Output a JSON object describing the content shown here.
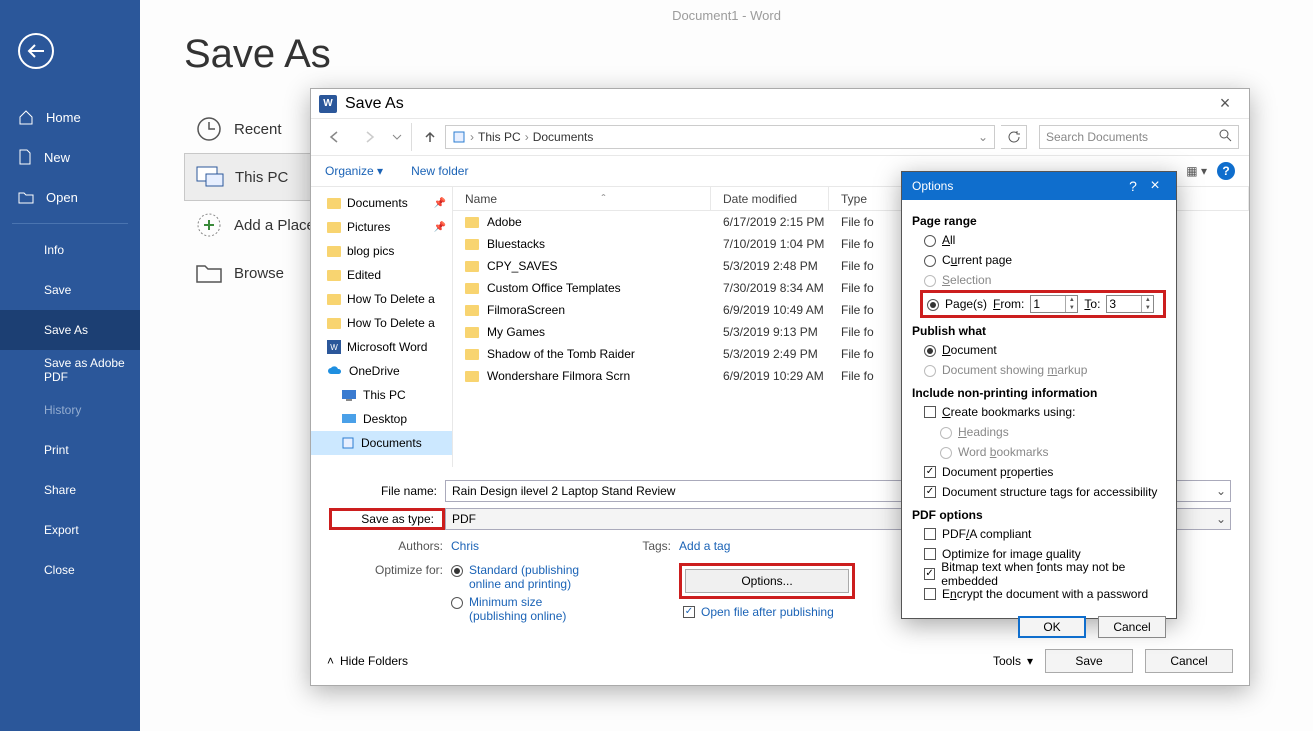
{
  "app_title": "Document1  -  Word",
  "backstage": {
    "title": "Save As",
    "nav": {
      "home": "Home",
      "new": "New",
      "open": "Open",
      "info": "Info",
      "save": "Save",
      "save_as": "Save As",
      "save_adobe": "Save as Adobe PDF",
      "history": "History",
      "print": "Print",
      "share": "Share",
      "export": "Export",
      "close": "Close"
    },
    "locations": {
      "recent": "Recent",
      "this_pc": "This PC",
      "add_place": "Add a Place",
      "browse": "Browse"
    }
  },
  "save_dialog": {
    "title": "Save As",
    "path": {
      "seg1": "This PC",
      "seg2": "Documents"
    },
    "search_placeholder": "Search Documents",
    "toolbar": {
      "organize": "Organize",
      "new_folder": "New folder"
    },
    "tree": [
      {
        "label": "Documents",
        "pin": true
      },
      {
        "label": "Pictures",
        "pin": true
      },
      {
        "label": "blog pics"
      },
      {
        "label": "Edited"
      },
      {
        "label": "How To Delete a"
      },
      {
        "label": "How To Delete a"
      },
      {
        "label": "Microsoft Word",
        "kind": "word"
      },
      {
        "label": "OneDrive",
        "kind": "cloud"
      },
      {
        "label": "This PC",
        "kind": "pc"
      },
      {
        "label": "Desktop",
        "kind": "desktop"
      },
      {
        "label": "Documents",
        "kind": "doclib",
        "sel": true
      }
    ],
    "columns": {
      "name": "Name",
      "date": "Date modified",
      "type": "Type"
    },
    "rows": [
      {
        "name": "Adobe",
        "date": "6/17/2019 2:15 PM",
        "type": "File fo"
      },
      {
        "name": "Bluestacks",
        "date": "7/10/2019 1:04 PM",
        "type": "File fo"
      },
      {
        "name": "CPY_SAVES",
        "date": "5/3/2019 2:48 PM",
        "type": "File fo"
      },
      {
        "name": "Custom Office Templates",
        "date": "7/30/2019 8:34 AM",
        "type": "File fo"
      },
      {
        "name": "FilmoraScreen",
        "date": "6/9/2019 10:49 AM",
        "type": "File fo"
      },
      {
        "name": "My Games",
        "date": "5/3/2019 9:13 PM",
        "type": "File fo"
      },
      {
        "name": "Shadow of the Tomb Raider",
        "date": "5/3/2019 2:49 PM",
        "type": "File fo"
      },
      {
        "name": "Wondershare Filmora Scrn",
        "date": "6/9/2019 10:29 AM",
        "type": "File fo"
      }
    ],
    "form": {
      "file_name_label": "File name:",
      "file_name": "Rain Design ilevel 2 Laptop Stand Review",
      "save_type_label": "Save as type:",
      "save_type": "PDF",
      "authors_label": "Authors:",
      "authors": "Chris",
      "tags_label": "Tags:",
      "tags": "Add a tag",
      "optimize_label": "Optimize for:",
      "opt_standard": "Standard (publishing online and printing)",
      "opt_min": "Minimum size (publishing online)",
      "options_btn": "Options...",
      "open_after": "Open file after publishing"
    },
    "bottom": {
      "hide_folders": "Hide Folders",
      "tools": "Tools",
      "save": "Save",
      "cancel": "Cancel"
    }
  },
  "options_dialog": {
    "title": "Options",
    "page_range": "Page range",
    "all": "All",
    "all_u": "A",
    "current": "Current page",
    "current_u": "u",
    "selection": "Selection",
    "selection_u": "S",
    "pages": "Page(s)",
    "from": "From:",
    "to": "To:",
    "from_val": "1",
    "to_val": "3",
    "publish_what": "Publish what",
    "document": "Document",
    "doc_u": "D",
    "markup": "Document showing markup",
    "markup_u": "m",
    "include": "Include non-printing information",
    "create_bookmarks": "Create bookmarks using:",
    "cb_u": "C",
    "headings": "Headings",
    "head_u": "H",
    "word_bm": "Word bookmarks",
    "wb_u": "b",
    "doc_props": "Document properties",
    "dp_u": "r",
    "struct_tags": "Document structure tags for accessibility",
    "pdf_options": "PDF options",
    "pdfa": "PDF/A compliant",
    "pdfa_u": "/",
    "img_quality": "Optimize for image quality",
    "iq_u": "q",
    "bitmap": "Bitmap text when fonts may not be embedded",
    "bm_u": "f",
    "encrypt": "Encrypt the document with a password",
    "en_u": "n",
    "ok": "OK",
    "cancel": "Cancel"
  }
}
